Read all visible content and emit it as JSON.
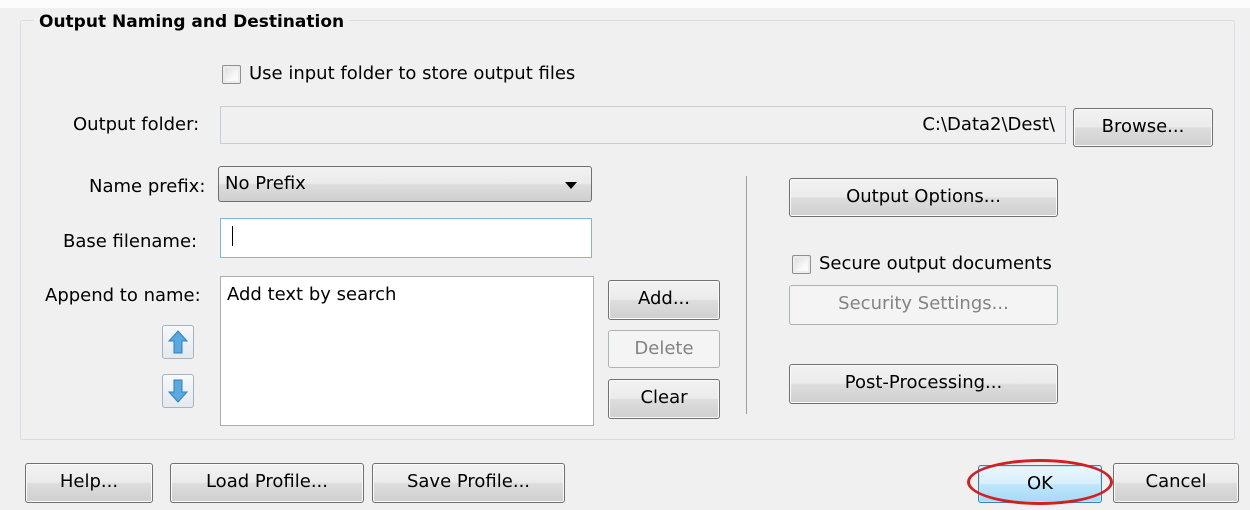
{
  "group": {
    "title": "Output Naming and Destination"
  },
  "use_input_folder": {
    "label": "Use input folder to store output files",
    "checked": false
  },
  "output_folder": {
    "label": "Output folder:",
    "value": "C:\\Data2\\Dest\\",
    "browse": "Browse..."
  },
  "name_prefix": {
    "label": "Name prefix:",
    "selected": "No Prefix"
  },
  "base_filename": {
    "label": "Base filename:",
    "value": ""
  },
  "append": {
    "label": "Append to name:",
    "items": [
      "Add text by search"
    ],
    "add": "Add...",
    "delete": "Delete",
    "clear": "Clear"
  },
  "right_panel": {
    "output_options": "Output Options...",
    "secure_label": "Secure output documents",
    "secure_checked": false,
    "security_settings": "Security Settings...",
    "post_processing": "Post-Processing..."
  },
  "footer": {
    "help": "Help...",
    "load_profile": "Load Profile...",
    "save_profile": "Save Profile...",
    "ok": "OK",
    "cancel": "Cancel"
  },
  "icons": {
    "up": "arrow-up-icon",
    "down": "arrow-down-icon",
    "dropdown": "chevron-down-icon"
  },
  "colors": {
    "highlight_ring": "#d21f1f",
    "arrow_blue": "#5aa9e0"
  }
}
